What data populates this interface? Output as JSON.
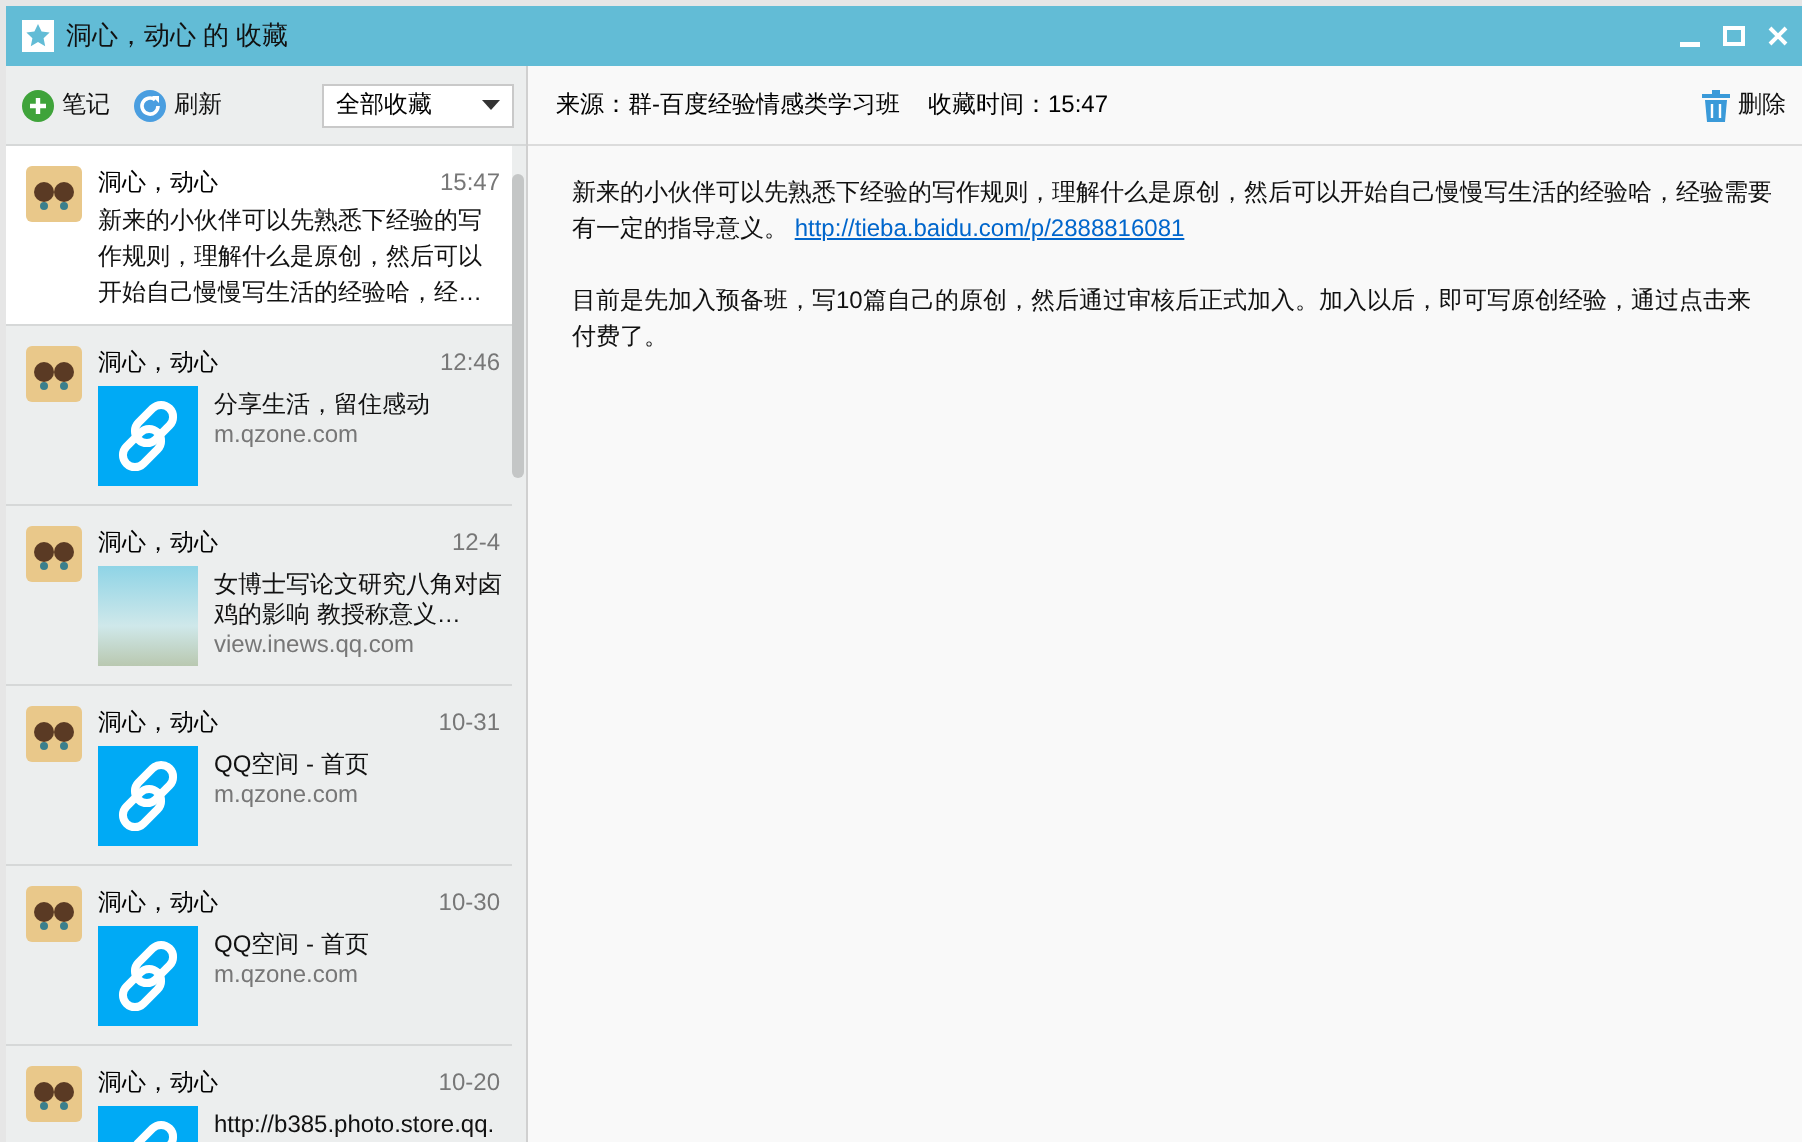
{
  "window": {
    "title": "洞心，动心 的 收藏"
  },
  "toolbar": {
    "note_button": "笔记",
    "refresh_button": "刷新",
    "filter": {
      "value": "全部收藏"
    }
  },
  "items": [
    {
      "kind": "text",
      "author": "洞心，动心",
      "time": "15:47",
      "selected": true,
      "text": "新来的小伙伴可以先熟悉下经验的写作规则，理解什么是原创，然后可以开始自己慢慢写生活的经验哈，经…"
    },
    {
      "kind": "link",
      "author": "洞心，动心",
      "time": "12:46",
      "selected": false,
      "title": "分享生活，留住感动",
      "domain": "m.qzone.com"
    },
    {
      "kind": "photo-link",
      "author": "洞心，动心",
      "time": "12-4",
      "selected": false,
      "title": "女博士写论文研究八角对卤鸡的影响 教授称意义…",
      "domain": "view.inews.qq.com"
    },
    {
      "kind": "link",
      "author": "洞心，动心",
      "time": "10-31",
      "selected": false,
      "title": "QQ空间 - 首页",
      "domain": "m.qzone.com"
    },
    {
      "kind": "link",
      "author": "洞心，动心",
      "time": "10-30",
      "selected": false,
      "title": "QQ空间 - 首页",
      "domain": "m.qzone.com"
    },
    {
      "kind": "link",
      "author": "洞心，动心",
      "time": "10-20",
      "selected": false,
      "title": "http://b385.photo.store.qq."
    }
  ],
  "detail": {
    "source": "来源：群-百度经验情感类学习班",
    "saved_time": "收藏时间：15:47",
    "delete_button": "删除",
    "paragraphs": [
      {
        "text": "新来的小伙伴可以先熟悉下经验的写作规则，理解什么是原创，然后可以开始自己慢慢写生活的经验哈，经验需要有一定的指导意义。",
        "link": "http://tieba.baidu.com/p/2888816081"
      },
      {
        "text": "目前是先加入预备班，写10篇自己的原创，然后通过审核后正式加入。加入以后，即可写原创经验，通过点击来付费了。"
      }
    ]
  }
}
